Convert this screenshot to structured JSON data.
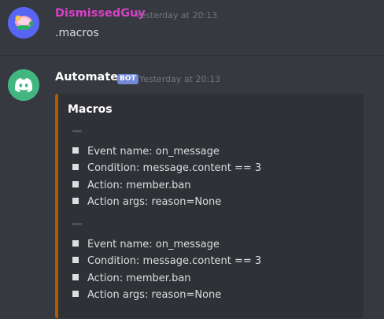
{
  "message1": {
    "author": "DismissedGuy",
    "timestamp": "Yesterday at 20:13",
    "content": ".macros"
  },
  "message2": {
    "author": "Automater",
    "badge": "BOT",
    "timestamp": "Yesterday at 20:13",
    "embed": {
      "accent_color": "#b05a00",
      "title": "Macros",
      "groups": [
        {
          "items": [
            "Event name: on_message",
            "Condition: message.content == 3",
            "Action: member.ban",
            "Action args: reason=None"
          ]
        },
        {
          "items": [
            "Event name: on_message",
            "Condition: message.content == 3",
            "Action: member.ban",
            "Action args: reason=None"
          ]
        }
      ]
    }
  },
  "icons": {
    "avatar1": "turtle-avatar-icon",
    "avatar2": "discord-logo-icon",
    "bullet": "square-bullet-icon"
  }
}
